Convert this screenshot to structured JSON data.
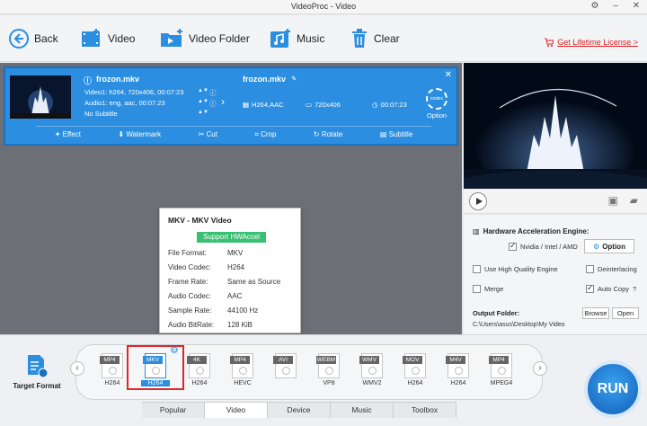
{
  "window": {
    "title": "VideoProc - Video"
  },
  "toolbar": {
    "back": "Back",
    "video": "Video",
    "video_folder": "Video Folder",
    "music": "Music",
    "clear": "Clear",
    "lifetime": "Get Lifetime License >"
  },
  "task": {
    "input_name": "frozon.mkv",
    "video_info": "Video1: h264, 720x406, 00:07:23",
    "audio_info": "Audio1: eng, aac, 00:07:23",
    "subtitle_info": "No Subtitle",
    "output_name": "frozon.mkv",
    "out_codec": "H264,AAC",
    "out_res": "720x406",
    "out_duration": "00:07:23",
    "codec_badge": "codec",
    "option": "Option",
    "edits": [
      "Effect",
      "Watermark",
      "Cut",
      "Crop",
      "Rotate",
      "Subtitle"
    ]
  },
  "popup": {
    "title": "MKV - MKV Video",
    "hw_badge": "Support HWAccel",
    "rows": [
      {
        "label": "File Format:",
        "value": "MKV"
      },
      {
        "label": "Video Codec:",
        "value": "H264"
      },
      {
        "label": "Frame Rate:",
        "value": "Same as Source"
      },
      {
        "label": "Audio Codec:",
        "value": "AAC"
      },
      {
        "label": "Sample Rate:",
        "value": "44100 Hz"
      },
      {
        "label": "Audio BitRate:",
        "value": "128 KiB"
      }
    ]
  },
  "settings": {
    "hw_title": "Hardware Acceleration Engine:",
    "nvidia": "Nvidia / Intel / AMD",
    "option_btn": "Option",
    "high_quality": "Use High Quality Engine",
    "deinterlacing": "Deinterlacing",
    "merge": "Merge",
    "auto_copy": "Auto Copy",
    "output_folder": "Output Folder:",
    "browse": "Browse",
    "open": "Open",
    "path": "C:\\Users\\asus\\Desktop\\My Video"
  },
  "formats": [
    {
      "tag": "MP4",
      "sub": "H264",
      "selected": false
    },
    {
      "tag": "MKV",
      "sub": "H264",
      "selected": true
    },
    {
      "tag": "4K",
      "sub": "H264",
      "selected": false
    },
    {
      "tag": "MP4",
      "sub": "HEVC",
      "selected": false
    },
    {
      "tag": "AVI",
      "sub": "",
      "selected": false
    },
    {
      "tag": "WEBM",
      "sub": "VP8",
      "selected": false
    },
    {
      "tag": "WMV",
      "sub": "WMV2",
      "selected": false
    },
    {
      "tag": "MOV",
      "sub": "H264",
      "selected": false
    },
    {
      "tag": "M4V",
      "sub": "H264",
      "selected": false
    },
    {
      "tag": "MP4",
      "sub": "MPEG4",
      "selected": false
    }
  ],
  "target_format": "Target Format",
  "tabs": [
    {
      "label": "Popular",
      "active": false
    },
    {
      "label": "Video",
      "active": true
    },
    {
      "label": "Device",
      "active": false
    },
    {
      "label": "Music",
      "active": false
    },
    {
      "label": "Toolbox",
      "active": false
    }
  ],
  "run": "RUN",
  "colors": {
    "accent": "#2b8ee0",
    "highlight": "#e0262a",
    "hw_badge": "#38c172"
  }
}
